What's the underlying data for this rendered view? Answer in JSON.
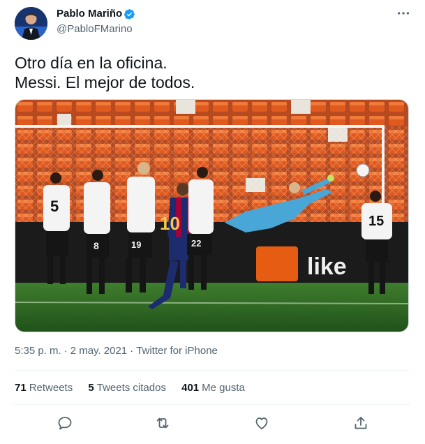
{
  "author": {
    "name": "Pablo Mariño",
    "handle": "@PabloFMarino",
    "verified": true
  },
  "tweet": {
    "lines": [
      "Otro día en la oficina.",
      "Messi. El mejor de todos."
    ]
  },
  "media": {
    "jersey_numbers": [
      "5",
      "8",
      "19",
      "10",
      "22",
      "15"
    ],
    "banner_text": "like"
  },
  "meta": {
    "time": "5:35 p. m.",
    "date": "2 may. 2021",
    "source": "Twitter for iPhone"
  },
  "stats": {
    "retweets_count": "71",
    "retweets_label": "Retweets",
    "quotes_count": "5",
    "quotes_label": "Tweets citados",
    "likes_count": "401",
    "likes_label": "Me gusta"
  },
  "icons": [
    "more-icon",
    "verified-icon",
    "reply-icon",
    "retweet-icon",
    "like-icon",
    "share-icon"
  ],
  "colors": {
    "verified": "#1d9bf0",
    "secondary_text": "#536471",
    "primary_text": "#0f1419"
  }
}
